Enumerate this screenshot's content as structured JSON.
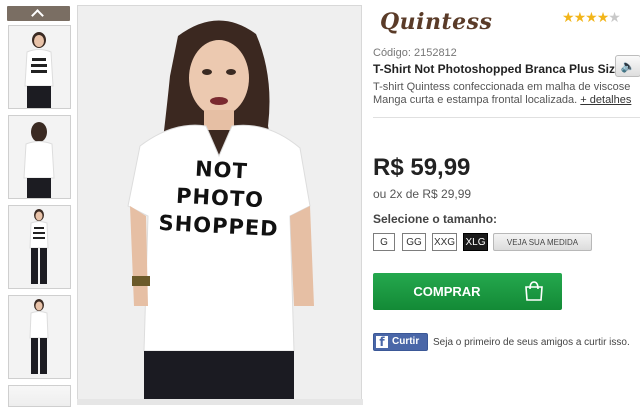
{
  "brand": {
    "name": "Quintess"
  },
  "rating": {
    "stars_filled": 4,
    "stars_total": 5,
    "icon": "star-icon"
  },
  "product": {
    "code": "Código: 2152812",
    "title": "T-Shirt Not Photoshopped Branca Plus Size",
    "desc_line1": "T-shirt Quintess confeccionada em malha de viscose",
    "desc_line2": "Manga curta e estampa frontal localizada.",
    "more_details": "+ detalhes",
    "shirt_print": [
      "NOT",
      "PHOTO",
      "SHOPPED"
    ]
  },
  "price": {
    "main": "R$ 59,99",
    "installment": "ou 2x de R$ 29,99"
  },
  "sizes": {
    "label": "Selecione o tamanho:",
    "options": [
      "G",
      "GG",
      "XXG",
      "XLG"
    ],
    "selected": "XLG",
    "measure_button": "VEJA SUA MEDIDA"
  },
  "buy": {
    "label": "COMPRAR",
    "icon": "shopping-bag-icon"
  },
  "facebook": {
    "like_label": "Curtir",
    "social_text": "Seja o primeiro de seus amigos a curtir isso."
  },
  "colors": {
    "buy_green": "#1f9a44",
    "brand_brown": "#5a3b28",
    "star_gold": "#f2b51a",
    "fb_blue": "#4a67a8"
  }
}
